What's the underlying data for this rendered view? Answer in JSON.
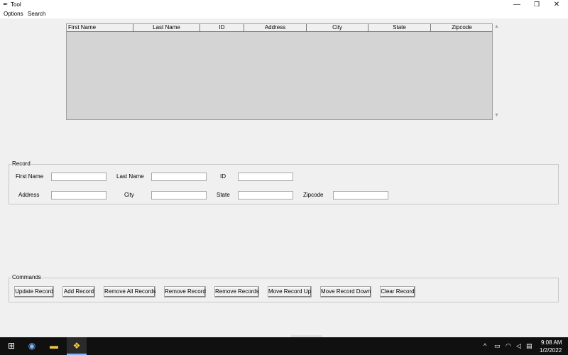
{
  "window": {
    "title": "Tool",
    "app_icon": "feather-icon",
    "min_glyph": "—",
    "restore_glyph": "❐",
    "close_glyph": "✕"
  },
  "menu": {
    "items": [
      "Options",
      "Search"
    ]
  },
  "tree": {
    "columns": [
      "First Name",
      "Last Name",
      "ID",
      "Address",
      "City",
      "State",
      "Zipcode"
    ],
    "rows": [],
    "scroll_up_glyph": "▲",
    "scroll_down_glyph": "▼"
  },
  "record": {
    "title": "Record",
    "labels": {
      "first_name": "First Name",
      "last_name": "Last Name",
      "id": "ID",
      "address": "Address",
      "city": "City",
      "state": "State",
      "zipcode": "Zipcode"
    },
    "values": {
      "first_name": "",
      "last_name": "",
      "id": "",
      "address": "",
      "city": "",
      "state": "",
      "zipcode": ""
    }
  },
  "commands": {
    "title": "Commands",
    "buttons": [
      "Update Record",
      "Add Record",
      "Remove All Records",
      "Remove Record",
      "Remove Records",
      "Move Record Up",
      "Move Record Down",
      "Clear Record"
    ]
  },
  "taskbar": {
    "icons": [
      "windows-start-icon",
      "browser-icon",
      "file-explorer-icon",
      "python-app-icon"
    ],
    "glyphs": {
      "start": "⊞",
      "browser": "◉",
      "explorer": "▬",
      "python": "❖",
      "chevron": "^",
      "battery": "▭",
      "wifi": "◠",
      "volume": "◁",
      "notify": "▤"
    },
    "time": "9:08 AM",
    "date": "1/2/2022"
  },
  "colors": {
    "tree_background": "#d4d4d4",
    "window_background": "#f0f0f0",
    "taskbar": "#101010"
  }
}
